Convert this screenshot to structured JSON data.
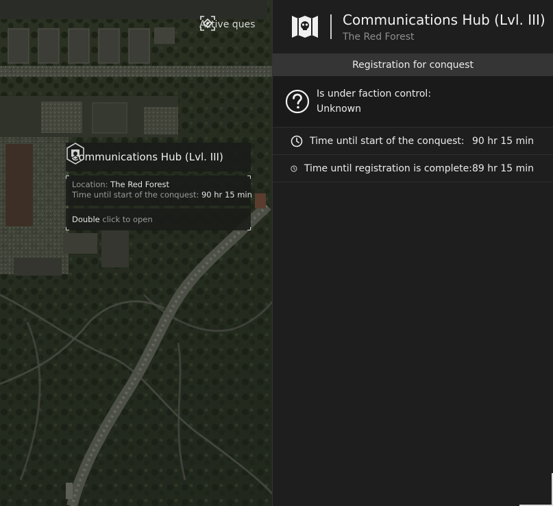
{
  "quest": {
    "label": "Active ques"
  },
  "tooltip": {
    "title": "Communications Hub (Lvl. III)",
    "location_label": "Location:",
    "location_value": "The Red Forest",
    "time_label": "Time until start of the conquest:",
    "time_value": "90 hr 15 min",
    "hint_strong": "Double",
    "hint_rest": "click to open"
  },
  "panel": {
    "title": "Communications Hub (Lvl. III)",
    "subtitle": "The Red Forest",
    "registration_label": "Registration for conquest",
    "control_label": "Is under faction control:",
    "control_value": "Unknown",
    "timers": [
      {
        "label": "Time until start of the conquest:",
        "value": "90 hr 15 min"
      },
      {
        "label": "Time until registration is complete:",
        "value": "89 hr 15 min"
      }
    ]
  },
  "colors": {
    "panel_bg": "#1e1e1e",
    "band_bg": "#353535",
    "accent_text": "#ececec",
    "muted_text": "#8e8e8e"
  }
}
